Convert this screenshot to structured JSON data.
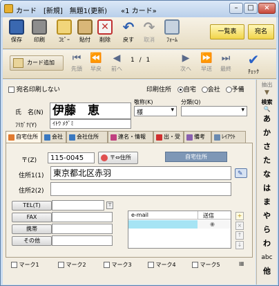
{
  "window": {
    "title": "カード　[新規]　無題1(更新)　　«1 カード»"
  },
  "toolbar": {
    "buttons": [
      {
        "label": "保存",
        "icon": "save-icon"
      },
      {
        "label": "印刷",
        "icon": "print-icon"
      },
      {
        "label": "ｺﾋﾟｰ",
        "icon": "copy-icon"
      },
      {
        "label": "貼付",
        "icon": "paste-icon"
      },
      {
        "label": "削除",
        "icon": "delete-icon"
      },
      {
        "label": "戻す",
        "icon": "undo-icon"
      },
      {
        "label": "取消",
        "icon": "redo-icon"
      },
      {
        "label": "ﾌｫｰﾑ",
        "icon": "form-icon"
      }
    ],
    "list_label": "一覧表",
    "name_label": "宛名"
  },
  "nav": {
    "add_card": "カード追加",
    "buttons": [
      "先頭",
      "早戻",
      "前へ",
      "次へ",
      "早送",
      "最終"
    ],
    "page_current": "1",
    "page_sep": "/",
    "page_total": "1",
    "check_label": "ﾁｪｯｸ"
  },
  "form": {
    "no_print_label": "宛名印刷しない",
    "print_addr_label": "印刷住所",
    "print_options": [
      "自宅",
      "会社",
      "予備"
    ],
    "print_selected": "自宅",
    "name_label": "氏　名(N)",
    "name_value": "伊藤　恵",
    "kana_label": "ﾌﾘｶﾞﾅ(Y)",
    "kana_value": "ｲﾄｳ ﾒｸﾞﾐ",
    "honorific_label": "敬称(K)",
    "honorific_value": "様",
    "category_label": "分類(Q)",
    "category_value": ""
  },
  "tabs": [
    {
      "label": "自宅住所",
      "active": true
    },
    {
      "label": "会社",
      "active": false
    },
    {
      "label": "会社住所",
      "active": false
    },
    {
      "label": "連名・情報",
      "active": false
    },
    {
      "label": "出・受",
      "active": false
    },
    {
      "label": "備考",
      "active": false
    },
    {
      "label": "ﾚｲｱｳﾄ",
      "active": false
    }
  ],
  "address": {
    "zip_label": "〒(Z)",
    "zip_value": "115-0045",
    "zip_button": "〒⇔住所",
    "section_label": "自宅住所",
    "addr1_label": "住所1(1)",
    "addr1_value": "東京都北区赤羽",
    "addr2_label": "住所2(2)",
    "addr2_value": "",
    "tel_label": "TEL(T)",
    "fax_label": "FAX",
    "mobile_label": "携帯",
    "other_label": "その他",
    "email_header": "e-mail",
    "send_header": "送信"
  },
  "marks": [
    "マーク1",
    "マーク2",
    "マーク3",
    "マーク4",
    "マーク5"
  ],
  "sidebar": {
    "extract_label": "抽出",
    "search_label": "検索",
    "kana": [
      "あ",
      "か",
      "さ",
      "た",
      "な",
      "は",
      "ま",
      "や",
      "ら",
      "わ",
      "abc",
      "他"
    ]
  }
}
